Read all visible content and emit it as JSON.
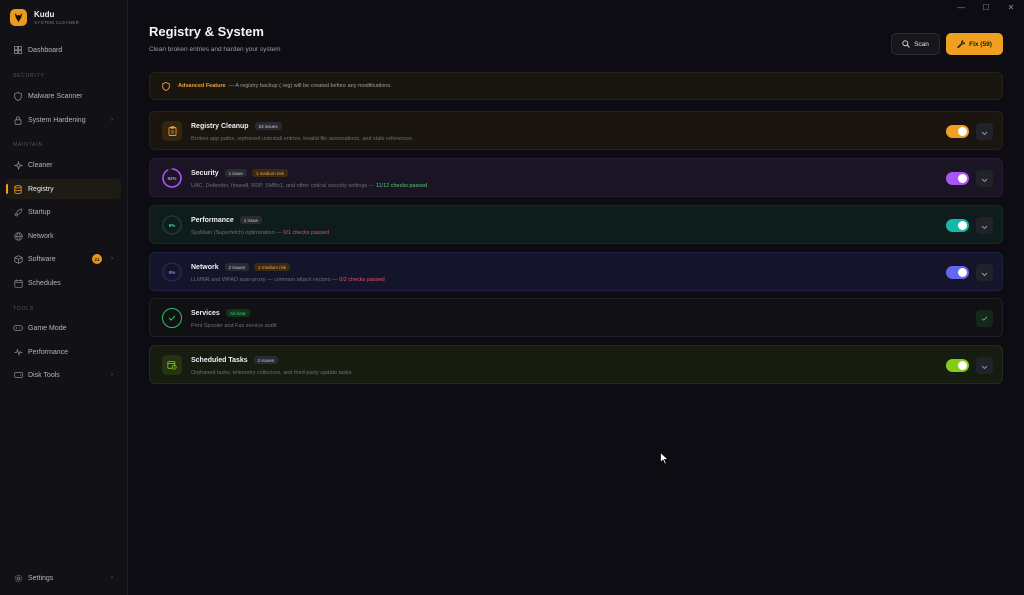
{
  "app": {
    "name": "Kudu",
    "subtitle": "SYSTEM CLEANER"
  },
  "window_controls": {
    "minimize": "—",
    "maximize": "☐",
    "close": "✕"
  },
  "sidebar": {
    "top": [
      {
        "label": "Dashboard",
        "icon": "grid-icon"
      }
    ],
    "sections": [
      {
        "title": "SECURITY",
        "items": [
          {
            "label": "Malware Scanner",
            "icon": "shield-icon"
          },
          {
            "label": "System Hardening",
            "icon": "lock-icon",
            "chevron": true
          }
        ]
      },
      {
        "title": "MAINTAIN",
        "items": [
          {
            "label": "Cleaner",
            "icon": "sparkle-icon"
          },
          {
            "label": "Registry",
            "icon": "database-icon",
            "active": true
          },
          {
            "label": "Startup",
            "icon": "rocket-icon"
          },
          {
            "label": "Network",
            "icon": "globe-icon"
          },
          {
            "label": "Software",
            "icon": "package-icon",
            "badge": "21",
            "chevron": true
          },
          {
            "label": "Schedules",
            "icon": "calendar-icon"
          }
        ]
      },
      {
        "title": "TOOLS",
        "items": [
          {
            "label": "Game Mode",
            "icon": "gamepad-icon"
          },
          {
            "label": "Performance",
            "icon": "pulse-icon"
          },
          {
            "label": "Disk Tools",
            "icon": "disk-icon",
            "chevron": true
          }
        ]
      }
    ],
    "settings": "Settings"
  },
  "header": {
    "title": "Registry & System",
    "subtitle": "Clean broken entries and harden your system",
    "scan_label": "Scan",
    "fix_label": "Fix (59)"
  },
  "banner": {
    "strong": "Advanced Feature",
    "text": "— A registry backup (.reg) will be created before any modifications."
  },
  "categories": [
    {
      "title": "Registry Cleanup",
      "pills": [
        "53 issues"
      ],
      "desc": "Broken app paths, orphaned uninstall entries, invalid file associations, and stale references",
      "status_text": "",
      "accent": "#f0a020",
      "enabled": true
    },
    {
      "title": "Security",
      "ring": "92%",
      "ring_value": 92,
      "pills": [
        "1 issue",
        "1 medium risk"
      ],
      "desc": "UAC, Defender, firewall, RDP, SMBv1, and other critical security settings — ",
      "status_text": "11/12 checks passed",
      "status": "pass",
      "accent": "#a855f7",
      "enabled": true
    },
    {
      "title": "Performance",
      "ring": "0%",
      "ring_value": 0,
      "pills": [
        "1 issue"
      ],
      "desc": "SysMain (Superfetch) optimization — ",
      "status_text": "0/1 checks passed",
      "status": "fail",
      "accent": "#14b8a6",
      "enabled": true
    },
    {
      "title": "Network",
      "ring": "0%",
      "ring_value": 0,
      "pills": [
        "2 issues",
        "2 medium risk"
      ],
      "desc": "LLMNR and WPAD auto-proxy — common attack vectors — ",
      "status_text": "0/2 checks passed",
      "status": "fail",
      "accent": "#6366f1",
      "enabled": true
    },
    {
      "title": "Services",
      "pills": [
        "All clear"
      ],
      "desc": "Print Spooler and Fax service audit",
      "status_text": "",
      "accent": "#22c55e",
      "complete": true
    },
    {
      "title": "Scheduled Tasks",
      "pills": [
        "2 issues"
      ],
      "desc": "Orphaned tasks, telemetry collectors, and third-party update tasks",
      "status_text": "",
      "accent": "#84cc16",
      "enabled": true
    }
  ]
}
